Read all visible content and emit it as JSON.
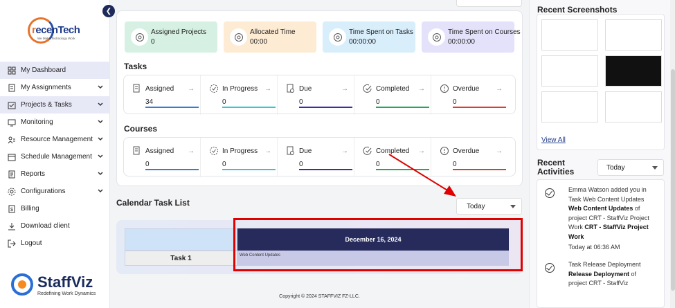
{
  "sidebar": {
    "company_logo": {
      "name": "recenTech",
      "tagline": "We Make Technology Work"
    },
    "items": [
      {
        "label": "My Dashboard",
        "icon": "dashboard-icon",
        "active": true,
        "expandable": false
      },
      {
        "label": "My Assignments",
        "icon": "assignments-icon",
        "active": false,
        "expandable": true
      },
      {
        "label": "Projects & Tasks",
        "icon": "projects-icon",
        "active": true,
        "expandable": true
      },
      {
        "label": "Monitoring",
        "icon": "monitoring-icon",
        "active": false,
        "expandable": true
      },
      {
        "label": "Resource Management",
        "icon": "resource-icon",
        "active": false,
        "expandable": true
      },
      {
        "label": "Schedule Management",
        "icon": "schedule-icon",
        "active": false,
        "expandable": true
      },
      {
        "label": "Reports",
        "icon": "reports-icon",
        "active": false,
        "expandable": true
      },
      {
        "label": "Configurations",
        "icon": "configurations-icon",
        "active": false,
        "expandable": true
      },
      {
        "label": "Billing",
        "icon": "billing-icon",
        "active": false,
        "expandable": false
      },
      {
        "label": "Download client",
        "icon": "download-icon",
        "active": false,
        "expandable": false
      },
      {
        "label": "Logout",
        "icon": "logout-icon",
        "active": false,
        "expandable": false
      }
    ],
    "brand": {
      "name": "StaffViz",
      "tagline": "Redefining Work Dynamics"
    }
  },
  "stats": [
    {
      "label": "Assigned Projects",
      "value": "0",
      "bg": "#d6f1e4",
      "icon": "assigned-projects-icon"
    },
    {
      "label": "Allocated Time",
      "value": "00:00",
      "bg": "#fdebd3",
      "icon": "allocated-time-icon"
    },
    {
      "label": "Time Spent on Tasks",
      "value": "00:00:00",
      "bg": "#d8eefb",
      "icon": "time-tasks-icon"
    },
    {
      "label": "Time Spent on Courses",
      "value": "00:00:00",
      "bg": "#e4e2fa",
      "icon": "time-courses-icon"
    }
  ],
  "tasks": {
    "title": "Tasks",
    "items": [
      {
        "label": "Assigned",
        "value": "34",
        "color": "#2f7fd8"
      },
      {
        "label": "In Progress",
        "value": "0",
        "color": "#2ec8d8"
      },
      {
        "label": "Due",
        "value": "0",
        "color": "#3b2fa8"
      },
      {
        "label": "Completed",
        "value": "0",
        "color": "#1fa857"
      },
      {
        "label": "Overdue",
        "value": "0",
        "color": "#e23b2e"
      }
    ]
  },
  "courses": {
    "title": "Courses",
    "items": [
      {
        "label": "Assigned",
        "value": "0",
        "color": "#2f7fd8"
      },
      {
        "label": "In Progress",
        "value": "0",
        "color": "#2ec8d8"
      },
      {
        "label": "Due",
        "value": "0",
        "color": "#3b2fa8"
      },
      {
        "label": "Completed",
        "value": "0",
        "color": "#1fa857"
      },
      {
        "label": "Overdue",
        "value": "0",
        "color": "#e23b2e"
      }
    ]
  },
  "calendar": {
    "title": "Calendar Task List",
    "filter": "Today",
    "date_header": "December 16, 2024",
    "task_label": "Task 1",
    "event": "Web Content Updates"
  },
  "footer": "Copyright © 2024 STAFFVIZ FZ-LLC.",
  "right_panel": {
    "screenshots_title": "Recent Screenshots",
    "view_all": "View All",
    "activities_title": "Recent Activities",
    "activities_filter": "Today",
    "activities": [
      {
        "text_1": "Emma Watson added you in Task Web Content Updates ",
        "bold_1": "Web Content Updates",
        "text_2": " of project CRT - StaffViz Project Work ",
        "bold_2": "CRT - StaffViz Project Work",
        "time": "Today at 06:36 AM"
      },
      {
        "text_1": "Task Release Deployment ",
        "bold_1": "Release Deployment",
        "text_2": " of project CRT - StaffViz",
        "bold_2": "",
        "time": ""
      }
    ]
  }
}
